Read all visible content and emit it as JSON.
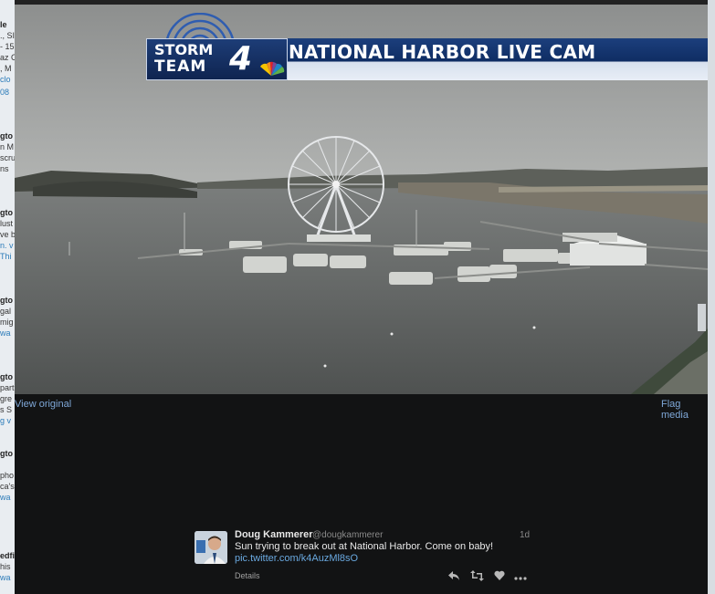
{
  "background_timeline": {
    "fragments": [
      "le",
      "., SI",
      "- 15",
      "az C",
      ", M",
      "clo",
      "08",
      "gto",
      "n M",
      "scru",
      "ns",
      "gto",
      "lust",
      "ve b",
      "n. v",
      "Thi",
      "gto",
      "gal",
      "mig",
      "wa",
      "gto",
      "part",
      "gre",
      "s S",
      "g v",
      "gto",
      "pho",
      "ca's",
      "wa",
      "edfi",
      "his",
      "wa"
    ]
  },
  "photo": {
    "banner_brand_top": "STORM",
    "banner_brand_bottom": "TEAM",
    "banner_brand_number": "4",
    "banner_title": "NATIONAL HARBOR LIVE CAM"
  },
  "links": {
    "view_original": "View original",
    "flag_media": "Flag media"
  },
  "tweet": {
    "name": "Doug Kammerer",
    "handle": "@dougkammerer",
    "time": "1d",
    "text": "Sun trying to break out at National Harbor. Come on baby!",
    "link": "pic.twitter.com/k4AuzMl8sO",
    "details": "Details",
    "actions": {
      "reply_icon": "reply-icon",
      "retweet_icon": "retweet-icon",
      "like_icon": "heart-icon",
      "more_icon": "more-icon"
    }
  },
  "colors": {
    "modal_bg": "#121314",
    "link": "#6aa9e0",
    "banner_blue": "#0f2d63"
  }
}
